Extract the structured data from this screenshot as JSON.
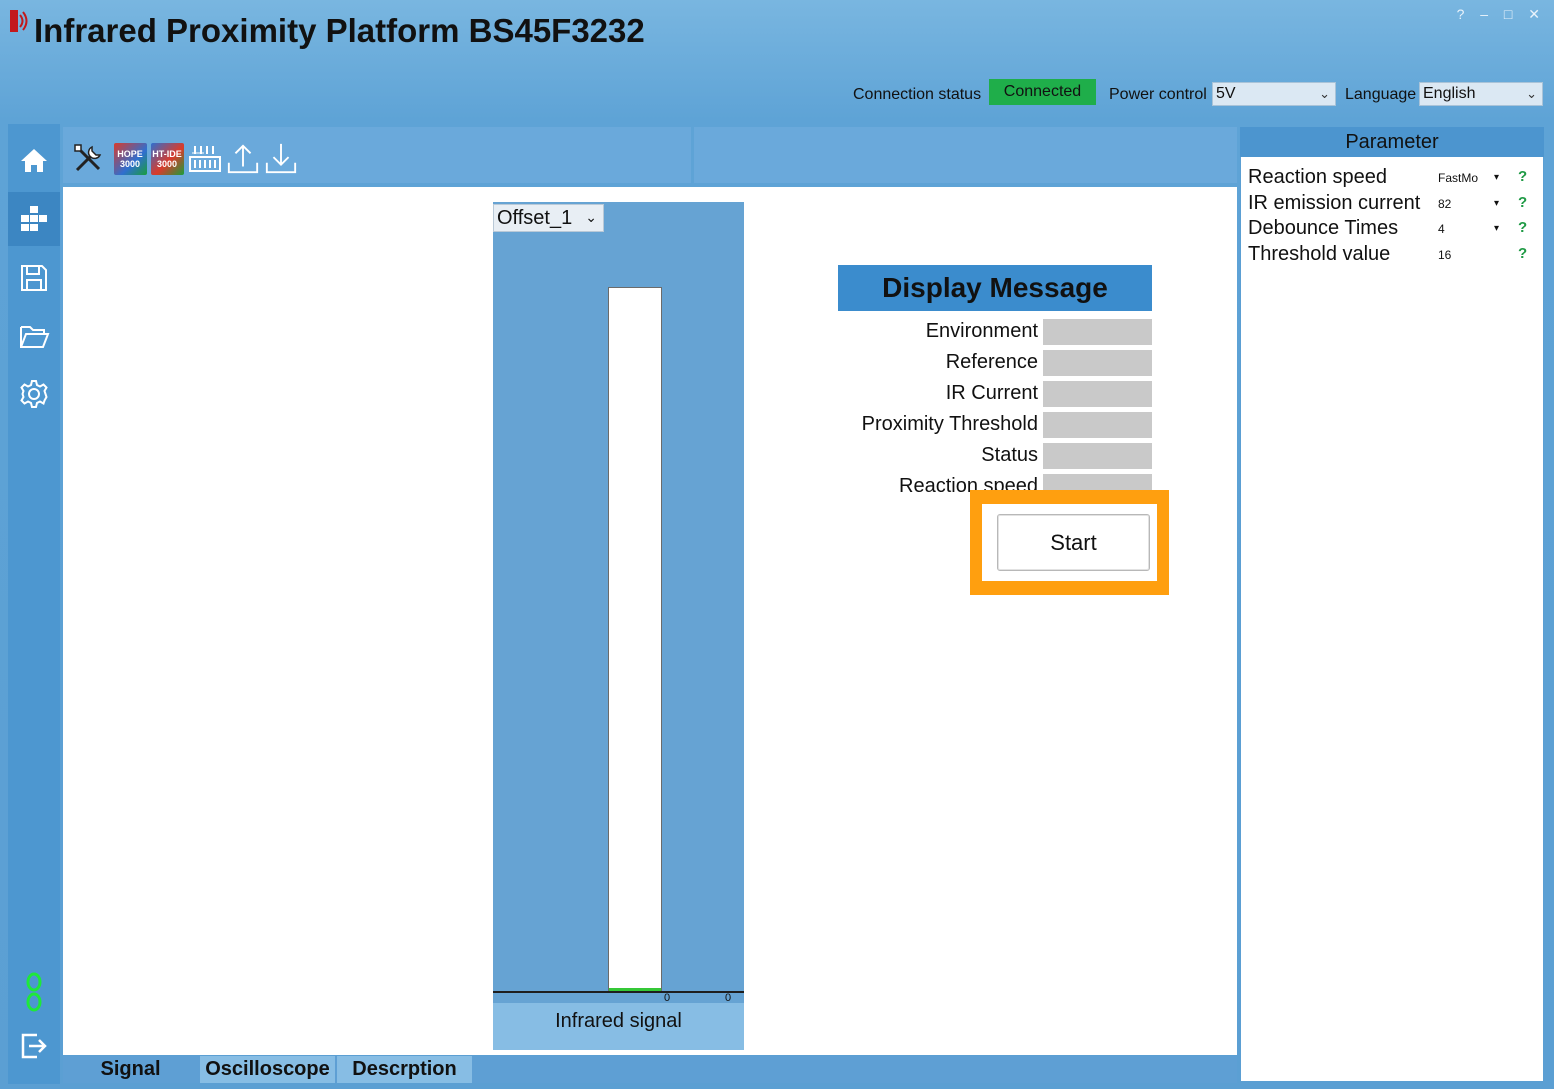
{
  "app": {
    "title": "Infrared Proximity Platform",
    "model": "BS45F3232",
    "window_controls": "? – □ ✕"
  },
  "status_bar": {
    "connection_label": "Connection status",
    "connection_value": "Connected",
    "power_label": "Power control",
    "power_value": "5V",
    "language_label": "Language",
    "language_value": "English"
  },
  "toolbar": {
    "hope_chip": [
      "HOPE",
      "3000"
    ],
    "htide_chip": [
      "HT-IDE",
      "3000"
    ]
  },
  "chart": {
    "selector": "Offset_1",
    "caption": "Infrared signal",
    "tick_left": "0",
    "tick_right": "0",
    "fill_fraction": 0
  },
  "display_message": {
    "title": "Display Message",
    "rows": [
      "Environment",
      "Reference",
      "IR Current",
      "Proximity Threshold",
      "Status",
      "Reaction speed"
    ],
    "start_label": "Start"
  },
  "parameter": {
    "title": "Parameter",
    "rows": [
      {
        "label": "Reaction speed",
        "value": "FastMo",
        "has_dropdown": true,
        "help": "?"
      },
      {
        "label": "IR emission current",
        "value": "82",
        "has_dropdown": true,
        "help": "?"
      },
      {
        "label": "Debounce Times",
        "value": "4",
        "has_dropdown": true,
        "help": "?"
      },
      {
        "label": "Threshold value",
        "value": "16",
        "has_dropdown": false,
        "help": "?"
      }
    ]
  },
  "tabs": [
    "Signal",
    "Oscilloscope",
    "Descrption"
  ],
  "colors": {
    "accent": "#4c95cf",
    "connected": "#1fae4a",
    "highlight": "#ff9f0f",
    "help": "#1f9a45"
  }
}
